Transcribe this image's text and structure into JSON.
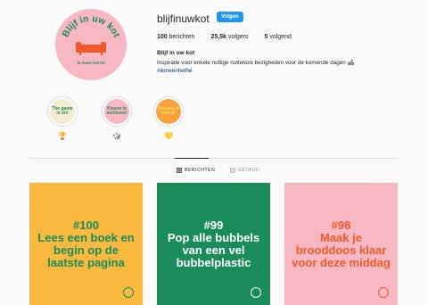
{
  "profile": {
    "username": "blijfinuwkot",
    "follow_label": "Volgen",
    "stats": [
      {
        "value": "100",
        "label": "berichten"
      },
      {
        "value": "25,5k",
        "label": "volgers"
      },
      {
        "value": "5",
        "label": "volgend"
      }
    ],
    "full_name": "Blijf in uw kot",
    "bio": "Inspiratie voor enkele nuttige nutteloze bezigheden voor de komende dagen 🛋",
    "hashtag": "#ikmeenhethé"
  },
  "avatar": {
    "top_text": "Blijf in uw kot",
    "bottom_text": "ik meen het hé",
    "bg_color": "#f7b8c3",
    "text_color": "#1a8c5a"
  },
  "highlights": [
    {
      "text": "The game is on!",
      "icon": "🏆",
      "bg_color": "#f4ecd0",
      "text_color": "#1a8c5a"
    },
    {
      "text": "Kiezen is verliezen!",
      "icon": "🎲",
      "bg_color": "#f7b8c3",
      "text_color": "#1a8c5a"
    },
    {
      "text": "Sharing is caring!",
      "icon": "💛",
      "bg_color": "#f9a03f",
      "text_color": "#f7e050"
    }
  ],
  "tabs": [
    {
      "label": "BERICHTEN",
      "icon": "grid-icon",
      "active": true
    },
    {
      "label": "GETAGD",
      "icon": "tag-icon",
      "active": false
    }
  ],
  "posts": [
    {
      "number": "#100",
      "text": "Lees een boek en begin op de laatste pagina",
      "bg_color": "#f9b93f",
      "text_color": "#1a8c5a"
    },
    {
      "number": "#99",
      "text": "Pop alle bubbels van een vel bubbelplastic",
      "bg_color": "#1a8c5a",
      "text_color": "#ffffff"
    },
    {
      "number": "#98",
      "text": "Maak je brooddoos klaar voor deze middag",
      "bg_color": "#f7b8c3",
      "text_color": "#f05a28"
    }
  ]
}
